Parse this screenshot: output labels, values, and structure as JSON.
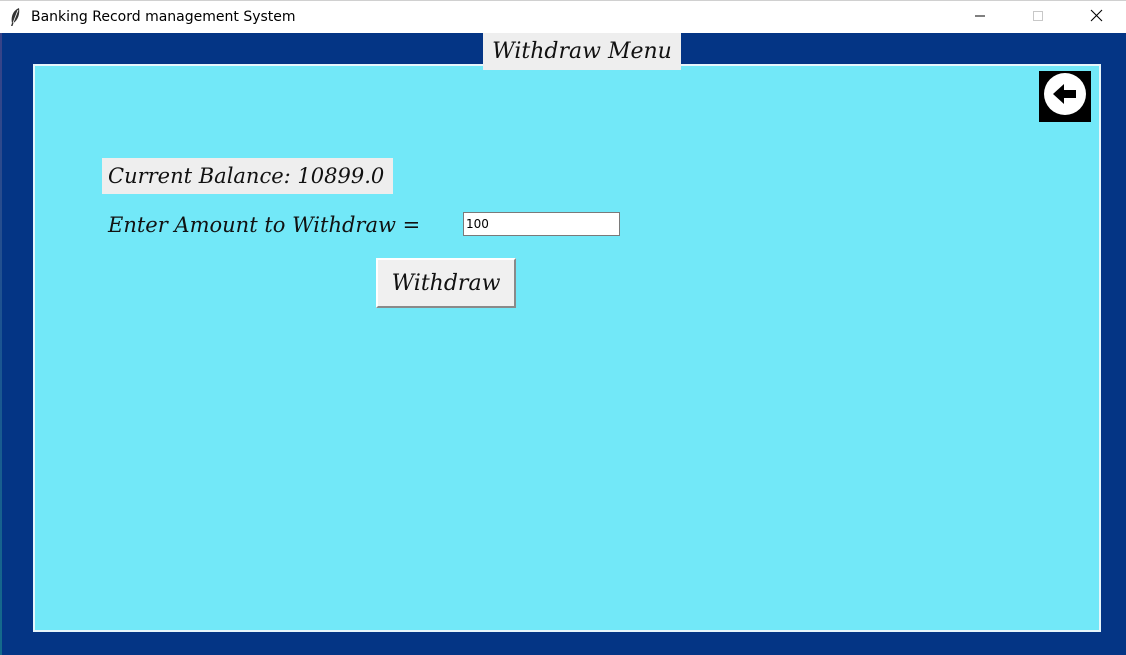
{
  "window": {
    "title": "Banking Record management System",
    "icons": {
      "app": "feather-icon",
      "minimize": "minimize-icon",
      "maximize": "maximize-icon",
      "close": "close-icon"
    }
  },
  "page": {
    "heading": "Withdraw Menu",
    "back_icon": "back-arrow-icon",
    "balance_text": "Current Balance: 10899.0",
    "amount_label": "Enter Amount to Withdraw =",
    "amount_value": "100",
    "withdraw_label": "Withdraw"
  },
  "colors": {
    "background": "#043585",
    "panel": "#72e8f8",
    "label_bg": "#eeeeee"
  }
}
